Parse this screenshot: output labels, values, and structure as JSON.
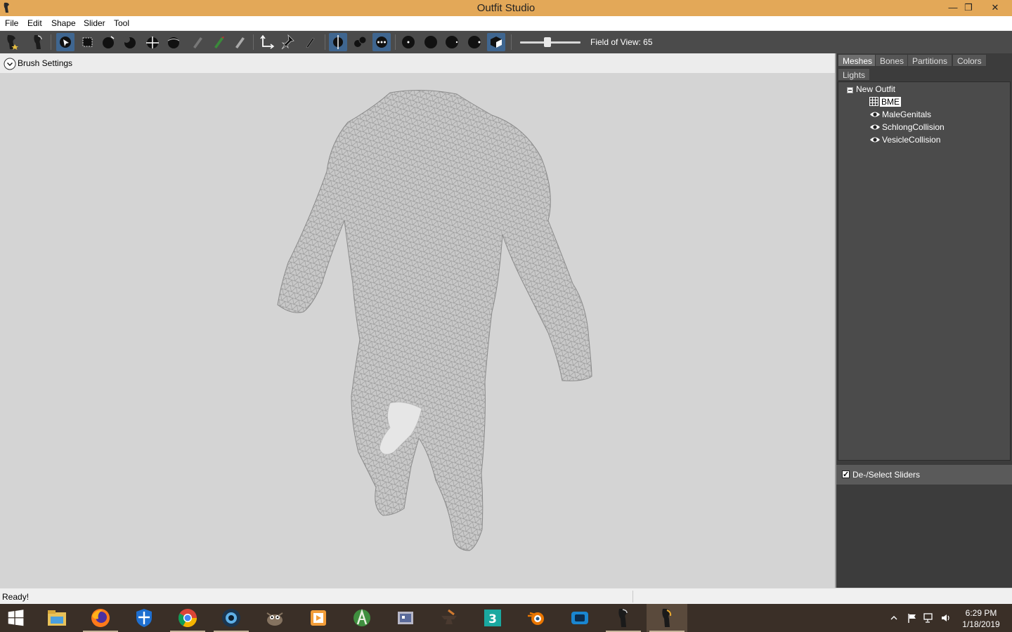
{
  "window": {
    "title": "Outfit Studio",
    "controls": {
      "minimize": "—",
      "restore": "❐",
      "close": "✕"
    }
  },
  "menu": [
    "File",
    "Edit",
    "Shape",
    "Slider",
    "Tool"
  ],
  "toolbar": {
    "fov_label": "Field of View: 65",
    "fov_value": 65,
    "tools": [
      "load-reference-icon",
      "load-outfit-icon",
      "select-brush-icon",
      "mask-brush-icon",
      "inflate-brush-icon",
      "deflate-brush-icon",
      "move-brush-icon",
      "smooth-brush-icon",
      "undiff-brush-icon",
      "weight-brush-icon",
      "color-brush-icon",
      "alpha-brush-icon",
      "transform-icon",
      "pivot-icon",
      "vertex-edit-icon",
      "x-mirror-icon",
      "connected-only-icon",
      "global-brush-icon",
      "show-mask-icon",
      "show-wireframe-icon",
      "show-lighting-icon",
      "show-textures-icon",
      "show-vertex-colors-icon"
    ]
  },
  "brush_settings": {
    "label": "Brush Settings"
  },
  "right_panel": {
    "tabs": [
      {
        "label": "Meshes",
        "active": true
      },
      {
        "label": "Bones",
        "active": false
      },
      {
        "label": "Partitions",
        "active": false
      },
      {
        "label": "Colors",
        "active": false
      },
      {
        "label": "Lights",
        "active": false
      }
    ],
    "tree": {
      "root": "New Outfit",
      "items": [
        {
          "label": "BME",
          "icon": "grid-icon",
          "selected": true
        },
        {
          "label": "MaleGenitals",
          "icon": "eye-icon",
          "selected": false
        },
        {
          "label": "SchlongCollision",
          "icon": "eye-icon",
          "selected": false
        },
        {
          "label": "VesicleCollision",
          "icon": "eye-icon",
          "selected": false
        }
      ]
    },
    "sliders": {
      "label": "De-/Select Sliders",
      "checked": true
    }
  },
  "status": {
    "text": "Ready!"
  },
  "taskbar": {
    "apps": [
      "windows-start-icon",
      "file-explorer-icon",
      "firefox-icon",
      "windows-defender-icon",
      "chrome-icon",
      "camera-app-icon",
      "gimp-icon",
      "media-player-icon",
      "android-studio-icon",
      "rpg-maker-icon",
      "anvil-tool-icon",
      "3ds-max-icon",
      "blender-icon",
      "film-app-icon",
      "bodyslide-icon",
      "outfit-studio-icon"
    ],
    "clock": {
      "time": "6:29 PM",
      "date": "1/18/2019"
    }
  },
  "colors": {
    "titlebar": "#e3a858",
    "toolbar": "#4b4b4b",
    "active_tool": "#3f6690",
    "viewport": "#d4d4d4",
    "panel": "#3c3c3c"
  }
}
